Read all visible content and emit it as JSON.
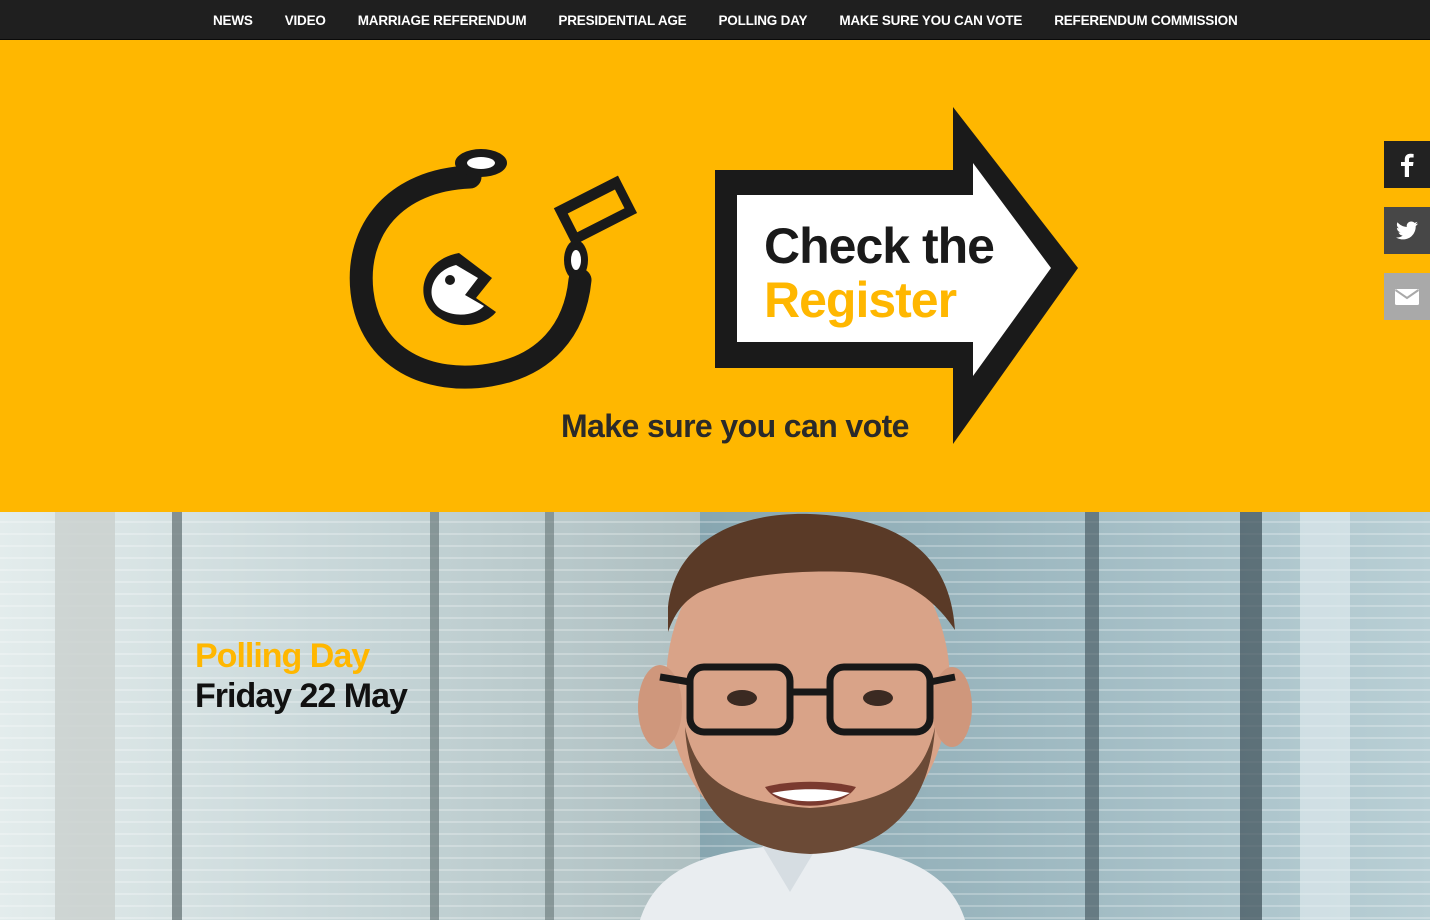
{
  "nav": {
    "items": [
      "NEWS",
      "VIDEO",
      "MARRIAGE REFERENDUM",
      "PRESIDENTIAL AGE",
      "POLLING DAY",
      "MAKE SURE YOU CAN VOTE",
      "REFERENDUM COMMISSION"
    ]
  },
  "hero": {
    "headline_line1": "Check the",
    "headline_line2": "Register",
    "tagline": "Make sure you can vote",
    "logo_icon": "ballot-whistle-icon",
    "arrow_icon": "arrow-right-icon"
  },
  "promo": {
    "label": "Polling Day",
    "date": "Friday 22 May"
  },
  "share": {
    "facebook_icon": "facebook-icon",
    "twitter_icon": "twitter-icon",
    "email_icon": "email-icon"
  },
  "colors": {
    "brand_yellow": "#ffb700",
    "nav_bg": "#1f1f1f",
    "ink": "#1a1a1a"
  }
}
